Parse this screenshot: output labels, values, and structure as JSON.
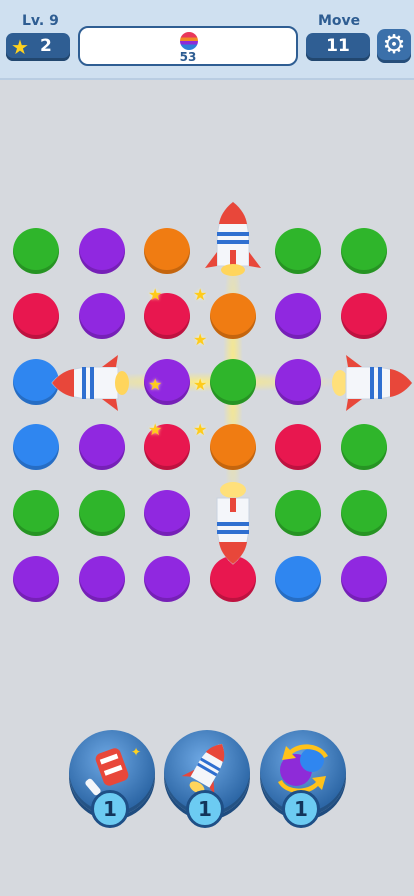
{
  "header": {
    "level_label": "Lv. 9",
    "stars_count": "2",
    "target_count": "53",
    "move_label": "Move",
    "moves_count": "11",
    "settings_icon": "gear-icon",
    "star_icon": "star-icon"
  },
  "board": {
    "colors": {
      "green": "#2fb52b",
      "purple": "#9028e0",
      "orange": "#f07c12",
      "red": "#e8174f",
      "blue": "#2f86f0"
    },
    "rows": [
      [
        "green",
        "purple",
        "orange",
        "rocket",
        "green",
        "green"
      ],
      [
        "red",
        "purple",
        "red",
        "orange",
        "purple",
        "red"
      ],
      [
        "blue",
        "rocket",
        "purple",
        "green",
        "purple",
        "rocket"
      ],
      [
        "blue",
        "purple",
        "red",
        "orange",
        "red",
        "green"
      ],
      [
        "green",
        "green",
        "purple",
        "rocket",
        "green",
        "green"
      ],
      [
        "purple",
        "purple",
        "purple",
        "red",
        "blue",
        "purple"
      ]
    ]
  },
  "boosters": [
    {
      "name": "hammer-booster",
      "icon": "hammer-icon",
      "count": "1"
    },
    {
      "name": "rocket-booster",
      "icon": "rocket-icon",
      "count": "1"
    },
    {
      "name": "shuffle-booster",
      "icon": "shuffle-icon",
      "count": "1"
    }
  ]
}
